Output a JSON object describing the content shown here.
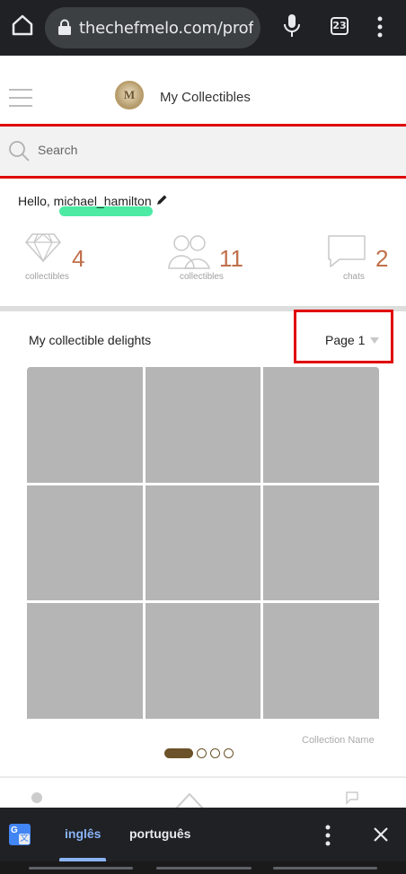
{
  "browser": {
    "url": "thechefmelo.com/profile_p",
    "tab_count": "23"
  },
  "header": {
    "title": "My Collectibles"
  },
  "search": {
    "placeholder": "Search"
  },
  "profile": {
    "greeting": "Hello, michael_hamilton",
    "stats": [
      {
        "icon": "diamond-icon",
        "value": "4",
        "label": "collectibles"
      },
      {
        "icon": "people-icon",
        "value": "11",
        "label": "collectibles"
      },
      {
        "icon": "chat-bubble-icon",
        "value": "2",
        "label": "chats"
      }
    ]
  },
  "collection": {
    "title": "My collectible delights",
    "page_select": "Page 1",
    "collection_name": "Collection Name",
    "grid_cells": 9,
    "pager": {
      "total": 4,
      "active": 1
    }
  },
  "translate": {
    "source_lang": "inglês",
    "target_lang": "português"
  },
  "colors": {
    "accent": "#c0704b",
    "annotation_red": "#e00000",
    "highlight_green": "#3ae89a",
    "pager_brown": "#6b5228"
  }
}
